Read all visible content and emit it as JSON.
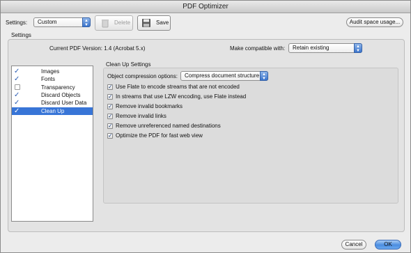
{
  "window": {
    "title": "PDF Optimizer"
  },
  "toolbar": {
    "settings_label": "Settings:",
    "settings_value": "Custom",
    "delete_label": "Delete",
    "save_label": "Save",
    "audit_label": "Audit space usage..."
  },
  "settings_group": {
    "title": "Settings",
    "current_version": "Current PDF Version: 1.4 (Acrobat 5.x)",
    "compat_label": "Make compatible with:",
    "compat_value": "Retain existing"
  },
  "panels": [
    {
      "label": "Images",
      "checked": true,
      "selected": false
    },
    {
      "label": "Fonts",
      "checked": true,
      "selected": false
    },
    {
      "label": "Transparency",
      "checked": false,
      "selected": false
    },
    {
      "label": "Discard Objects",
      "checked": true,
      "selected": false
    },
    {
      "label": "Discard User Data",
      "checked": true,
      "selected": false
    },
    {
      "label": "Clean Up",
      "checked": true,
      "selected": true
    }
  ],
  "cleanup": {
    "title": "Clean Up Settings",
    "compression_label": "Object compression options:",
    "compression_value": "Compress document structure",
    "options": [
      {
        "label": "Use Flate to encode streams that are not encoded",
        "checked": true
      },
      {
        "label": "In streams that use LZW encoding, use Flate instead",
        "checked": true
      },
      {
        "label": "Remove invalid bookmarks",
        "checked": true
      },
      {
        "label": "Remove invalid links",
        "checked": true
      },
      {
        "label": "Remove unreferenced named destinations",
        "checked": true
      },
      {
        "label": "Optimize the PDF for fast web view",
        "checked": true
      }
    ]
  },
  "footer": {
    "cancel_label": "Cancel",
    "ok_label": "OK"
  },
  "colors": {
    "selection": "#3875d7",
    "accent": "#4b8de0"
  }
}
